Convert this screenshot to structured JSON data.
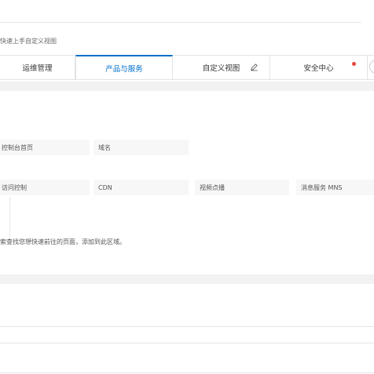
{
  "hint_text": "快速上手自定义视图",
  "tabs": [
    {
      "label": "运维管理"
    },
    {
      "label": "产品与服务"
    },
    {
      "label": "自定义视图",
      "icon": "pencil-icon"
    },
    {
      "label": "安全中心",
      "badge_color": "#e5473a"
    }
  ],
  "accent_color": "#0070cc",
  "shortcuts": {
    "row1": [
      "控制台首页",
      "域名"
    ],
    "row2": [
      "访问控制",
      "CDN",
      "视频点播",
      "消息服务 MNS"
    ]
  },
  "bottom_hint": "索查找您想快速前往的页面，添加到此区域。"
}
